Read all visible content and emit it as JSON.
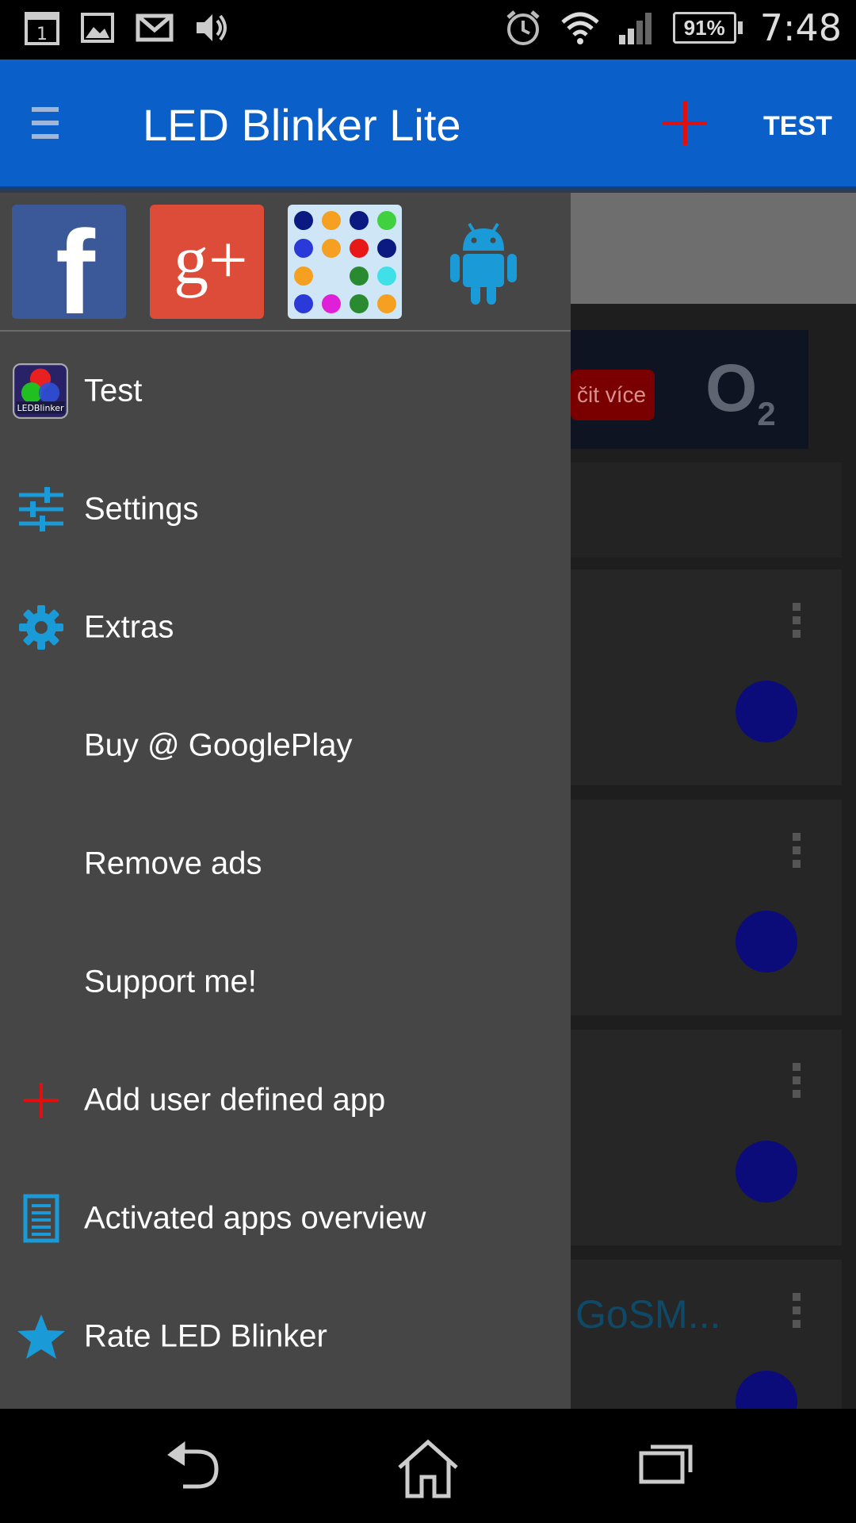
{
  "status_bar": {
    "time": "7:48",
    "battery": "91%",
    "icons": [
      "calendar-icon",
      "gallery-icon",
      "gmail-icon",
      "volume-icon",
      "alarm-icon",
      "wifi-icon",
      "signal-icon",
      "battery-icon"
    ],
    "calendar_day": "1"
  },
  "app_bar": {
    "title": "LED Blinker Lite",
    "action_label": "TEST"
  },
  "drawer": {
    "social": [
      "facebook",
      "google-plus",
      "led-dots",
      "android"
    ],
    "items": [
      {
        "label": "Test",
        "icon": "led-blinker-logo-icon"
      },
      {
        "label": "Settings",
        "icon": "sliders-icon"
      },
      {
        "label": "Extras",
        "icon": "gear-icon"
      },
      {
        "label": "Buy @ GooglePlay",
        "icon": ""
      },
      {
        "label": "Remove ads",
        "icon": ""
      },
      {
        "label": "Support me!",
        "icon": ""
      },
      {
        "label": "Add user defined app",
        "icon": "plus-icon"
      },
      {
        "label": "Activated apps overview",
        "icon": "list-icon"
      },
      {
        "label": "Rate LED Blinker",
        "icon": "star-icon"
      }
    ]
  },
  "background": {
    "ad_button": "čit více",
    "ad_brand": "O",
    "ad_brand_sub": "2",
    "row4_text": "GoSM..."
  },
  "colors": {
    "app_bar": "#0b5fc8",
    "drawer": "#464646",
    "accent_icon": "#1a9ad6",
    "plus_red": "#e01010"
  }
}
